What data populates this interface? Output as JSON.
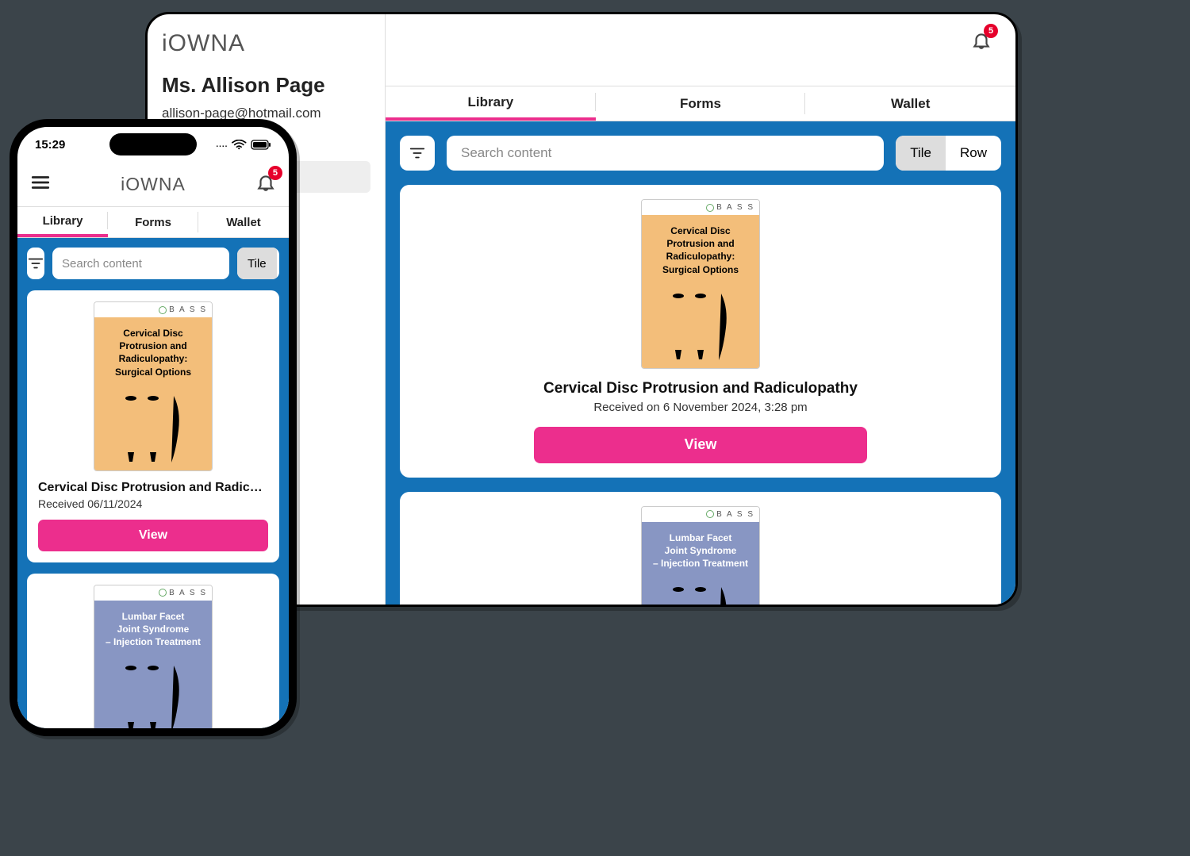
{
  "brand": "iOWNA",
  "user": {
    "display_name": "Ms. Allison Page",
    "email": "allison-page@hotmail.com"
  },
  "notifications": {
    "count": "5"
  },
  "tabs": {
    "library": "Library",
    "forms": "Forms",
    "wallet": "Wallet"
  },
  "search": {
    "placeholder": "Search content"
  },
  "view_toggle": {
    "tile": "Tile",
    "row": "Row"
  },
  "bass_label": "B A S S",
  "cards": {
    "cervical": {
      "thumb_title_l1": "Cervical Disc",
      "thumb_title_l2": "Protrusion and",
      "thumb_title_l3": "Radiculopathy:",
      "thumb_title_l4": "Surgical Options",
      "title": "Cervical Disc Protrusion and Radiculopathy",
      "received_tablet": "Received on 6 November 2024, 3:28 pm",
      "title_phone": "Cervical Disc Protrusion and Radiculopa...",
      "received_phone": "Received 06/11/2024"
    },
    "lumbar": {
      "thumb_title_l1": "Lumbar Facet",
      "thumb_title_l2": "Joint Syndrome",
      "thumb_title_l3": "– Injection Treatment"
    }
  },
  "btn": {
    "view": "View"
  },
  "phone": {
    "clock": "15:29"
  }
}
